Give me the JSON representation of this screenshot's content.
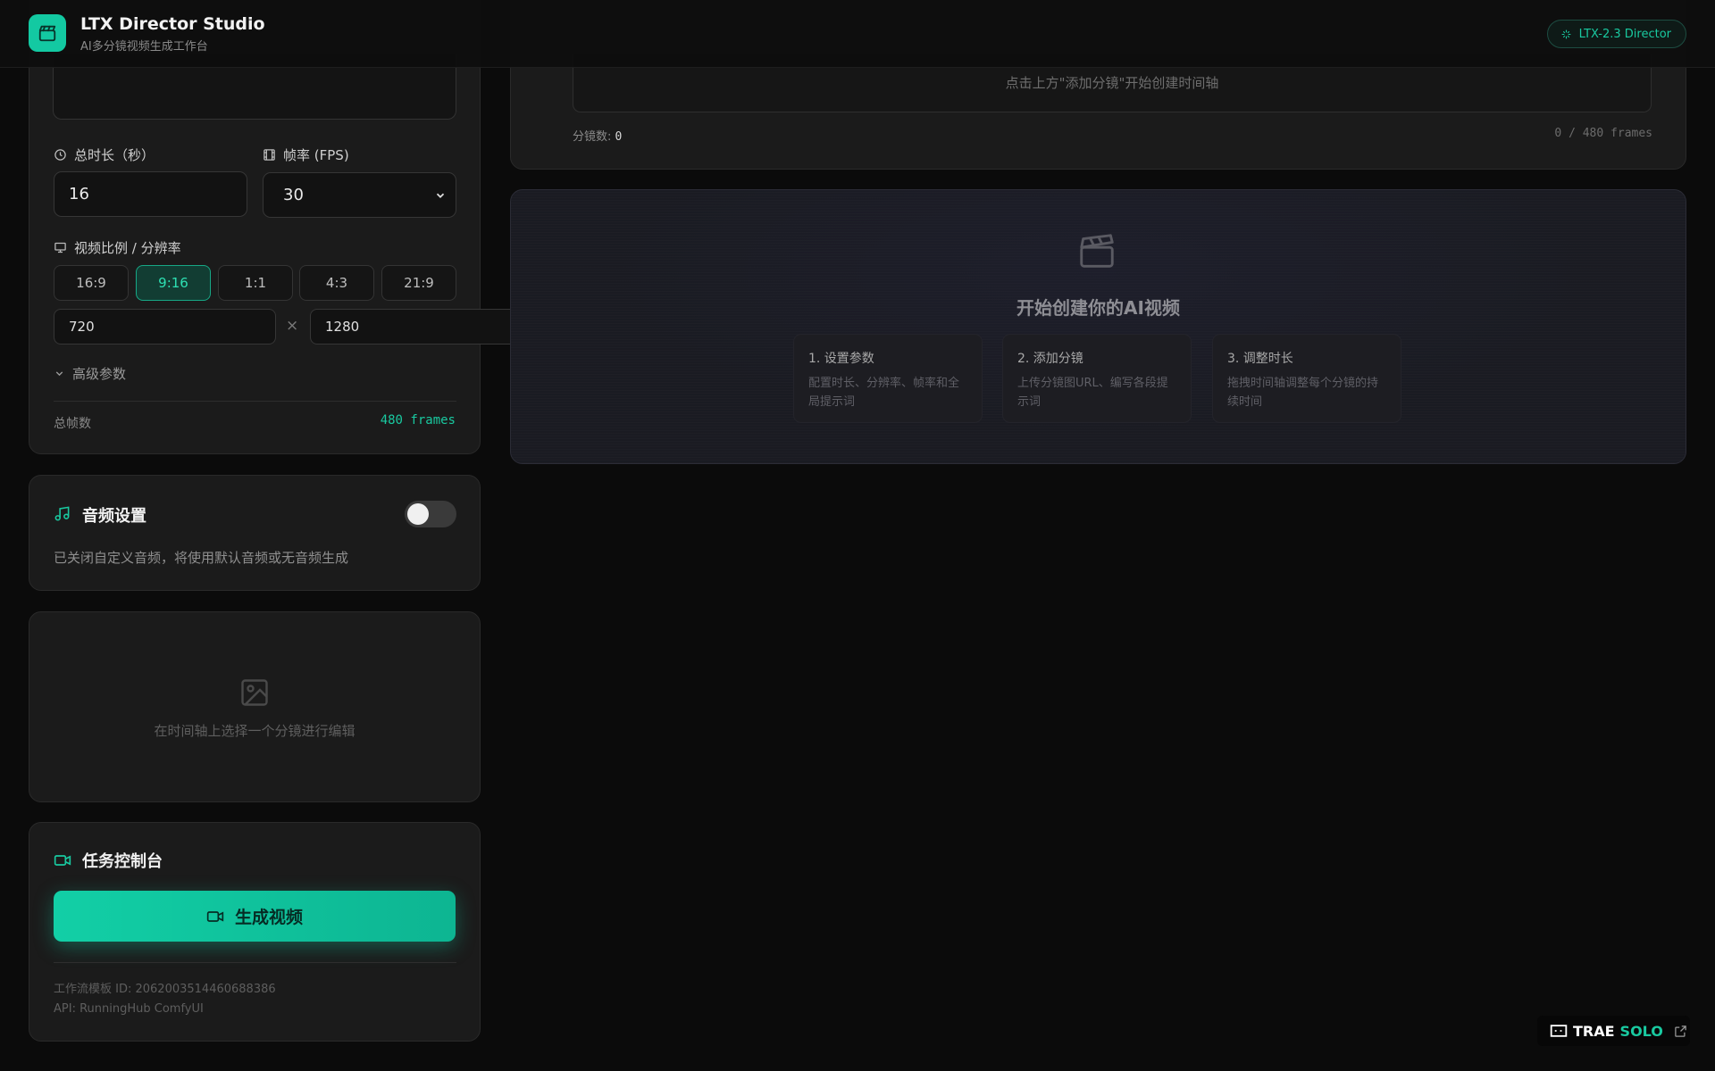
{
  "header": {
    "title": "LTX Director Studio",
    "subtitle": "AI多分镜视频生成工作台",
    "model_badge": "LTX-2.3 Director"
  },
  "params": {
    "duration_label": "总时长（秒）",
    "duration_value": "16",
    "fps_label": "帧率 (FPS)",
    "fps_value": "30",
    "ratio_label": "视频比例 / 分辨率",
    "ratios": [
      "16:9",
      "9:16",
      "1:1",
      "4:3",
      "21:9"
    ],
    "selected_ratio": "9:16",
    "width": "720",
    "times": "×",
    "height": "1280",
    "advanced_label": "高级参数",
    "total_frames_label": "总帧数",
    "total_frames_value": "480 frames"
  },
  "audio": {
    "title": "音频设置",
    "enabled": false,
    "description": "已关闭自定义音频，将使用默认音频或无音频生成"
  },
  "editor": {
    "empty_text": "在时间轴上选择一个分镜进行编辑"
  },
  "task": {
    "title": "任务控制台",
    "generate_label": "生成视频",
    "workflow_id": "工作流模板 ID: 2062003514460688386",
    "api": "API: RunningHub ComfyUI"
  },
  "timeline": {
    "empty_hint": "点击上方\"添加分镜\"开始创建时间轴",
    "shot_count_label": "分镜数:",
    "shot_count_value": "0",
    "frames_summary": "0 / 480 frames"
  },
  "preview": {
    "title": "开始创建你的AI视频",
    "steps": [
      {
        "title": "1. 设置参数",
        "desc": "配置时长、分辨率、帧率和全局提示词"
      },
      {
        "title": "2. 添加分镜",
        "desc": "上传分镜图URL、编写各段提示词"
      },
      {
        "title": "3. 调整时长",
        "desc": "拖拽时间轴调整每个分镜的持续时间"
      }
    ]
  },
  "trae_badge": {
    "text_a": "TRAE",
    "text_b": "SOLO"
  },
  "colors": {
    "accent": "#13c9a2",
    "background": "#0b0b0b",
    "card": "#1b1b1b"
  }
}
